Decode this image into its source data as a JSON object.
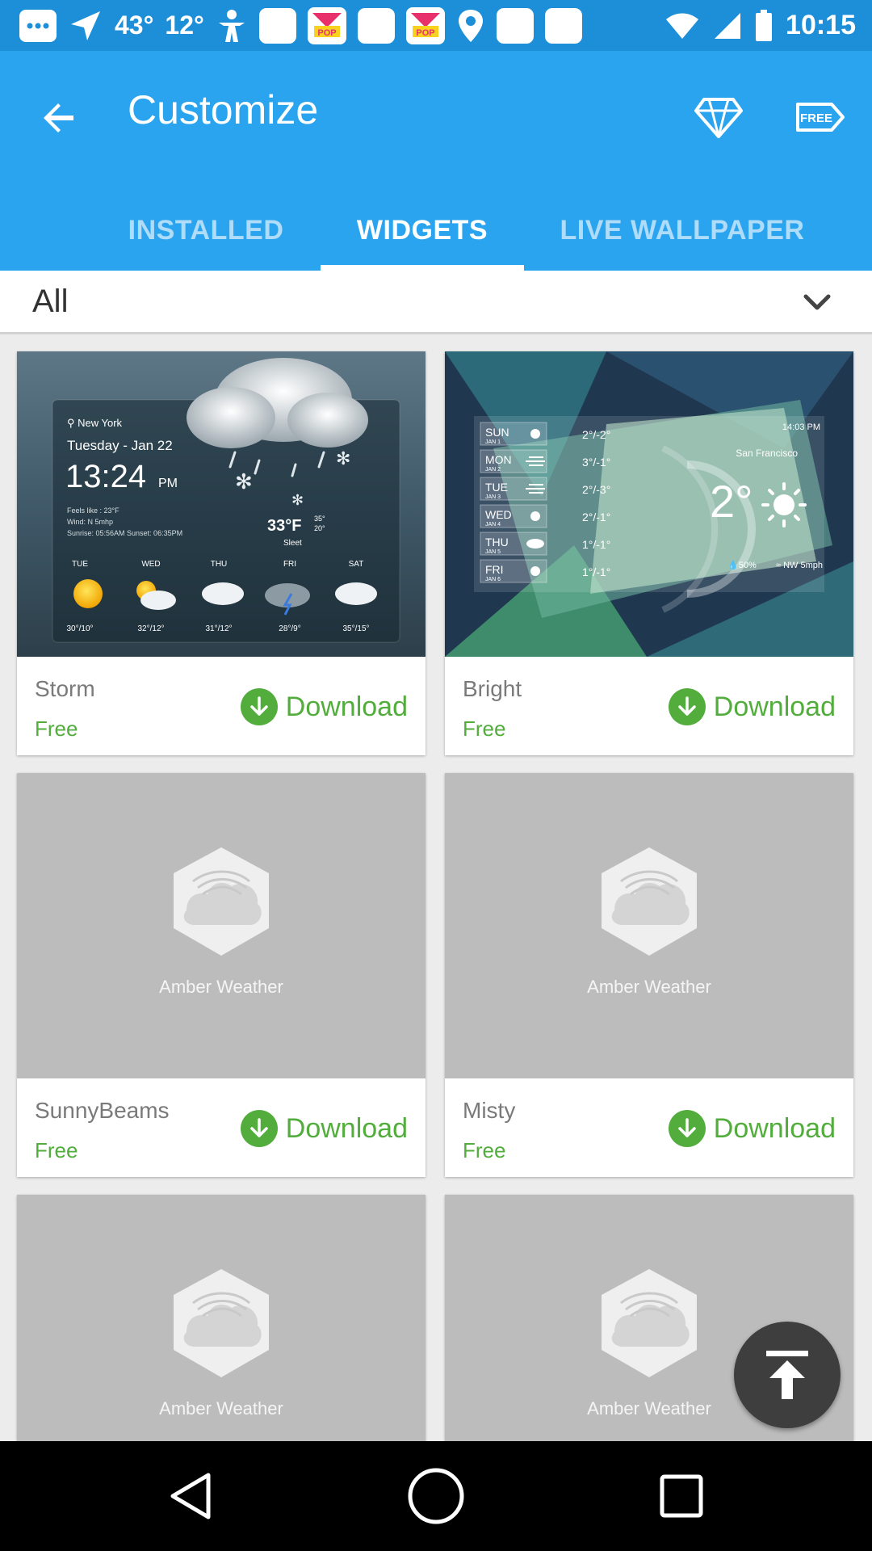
{
  "status_bar": {
    "temp1": "43°",
    "temp2": "12°",
    "pop_label": "POP",
    "time": "10:15"
  },
  "header": {
    "title": "Customize",
    "tabs": [
      {
        "label": "INSTALLED",
        "active": false
      },
      {
        "label": "WIDGETS",
        "active": true
      },
      {
        "label": "LIVE WALLPAPER",
        "active": false
      }
    ]
  },
  "filter": {
    "selected": "All"
  },
  "storm_preview": {
    "city": "New York",
    "date": "Tuesday - Jan 22",
    "time": "13:24",
    "ampm": "PM",
    "details": [
      "Feels like : 23°F",
      "Wind: N 5mhp",
      "Sunrise: 05:56AM    Sunset: 06:35PM"
    ],
    "temp": "33°F",
    "hi": "35°",
    "lo": "20°",
    "condition": "Sleet",
    "days": [
      {
        "day": "TUE",
        "temps": "30°/10°"
      },
      {
        "day": "WED",
        "temps": "32°/12°"
      },
      {
        "day": "THU",
        "temps": "31°/12°"
      },
      {
        "day": "FRI",
        "temps": "28°/9°"
      },
      {
        "day": "SAT",
        "temps": "35°/15°"
      }
    ]
  },
  "bright_preview": {
    "time": "14:03 PM",
    "city": "San Francisco",
    "temp": "2°",
    "humidity": "50%",
    "wind": "NW 5mph",
    "days": [
      {
        "day": "SUN",
        "date": "JAN 1",
        "temps": "2°/-2°"
      },
      {
        "day": "MON",
        "date": "JAN 2",
        "temps": "3°/-1°"
      },
      {
        "day": "TUE",
        "date": "JAN 3",
        "temps": "2°/-3°"
      },
      {
        "day": "WED",
        "date": "JAN 4",
        "temps": "2°/-1°"
      },
      {
        "day": "THU",
        "date": "JAN 5",
        "temps": "1°/-1°"
      },
      {
        "day": "FRI",
        "date": "JAN 6",
        "temps": "1°/-1°"
      }
    ]
  },
  "placeholder_caption": "Amber Weather",
  "widgets": [
    {
      "name": "Storm",
      "price": "Free",
      "action": "Download"
    },
    {
      "name": "Bright",
      "price": "Free",
      "action": "Download"
    },
    {
      "name": "SunnyBeams",
      "price": "Free",
      "action": "Download"
    },
    {
      "name": "Misty",
      "price": "Free",
      "action": "Download"
    }
  ],
  "colors": {
    "appbar": "#2aa4ef",
    "statusbar": "#1d8ed8",
    "accent_green": "#52ad3c",
    "placeholder_gray": "#bcbcbc"
  },
  "icons": [
    "back-arrow-icon",
    "diamond-icon",
    "free-tag-icon",
    "chevron-down-icon",
    "download-icon",
    "amber-weather-logo-icon",
    "scroll-to-top-icon",
    "nav-back-icon",
    "nav-home-icon",
    "nav-recents-icon"
  ]
}
